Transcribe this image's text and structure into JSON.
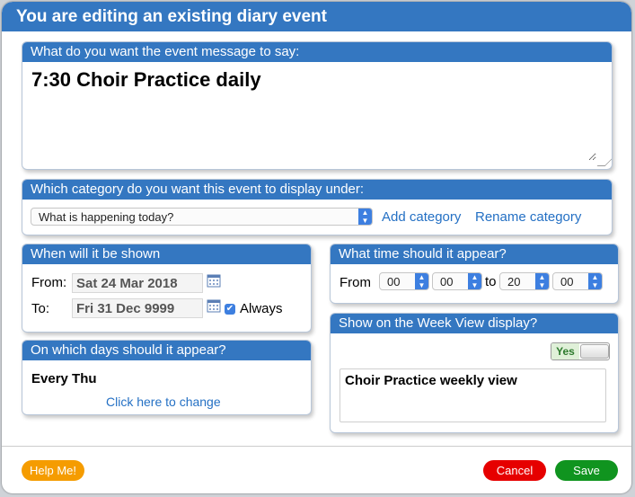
{
  "dialog": {
    "title": "You are editing an existing diary event"
  },
  "message": {
    "header": "What do you want the event message to say:",
    "text": "7:30 Choir Practice daily"
  },
  "category": {
    "header": "Which category do you want this event to display under:",
    "selected": "What is happening today?",
    "add_label": "Add category",
    "rename_label": "Rename category"
  },
  "shown": {
    "header": "When will it be shown",
    "from_label": "From:",
    "from_value": "Sat 24 Mar 2018",
    "to_label": "To:",
    "to_value": "Fri 31 Dec 9999",
    "always_label": "Always",
    "always_checked": true
  },
  "time": {
    "header": "What time should it appear?",
    "from_label": "From",
    "from_hour": "00",
    "from_min": "00",
    "to_label": "to",
    "to_hour": "20",
    "to_min": "00"
  },
  "days": {
    "header": "On which days should it appear?",
    "value": "Every Thu",
    "change_link": "Click here to change"
  },
  "week_view": {
    "header": "Show on the Week View display?",
    "toggle_label": "Yes",
    "toggle_on": true,
    "text": "Choir Practice weekly view"
  },
  "footer": {
    "help_label": "Help Me!",
    "cancel_label": "Cancel",
    "save_label": "Save"
  },
  "colors": {
    "accent": "#3477c1",
    "help": "#f59c00",
    "cancel": "#e60000",
    "save": "#10941f",
    "link": "#2470c4"
  },
  "icons": [
    "calendar-icon",
    "checkbox-icon",
    "select-arrow-icon"
  ]
}
